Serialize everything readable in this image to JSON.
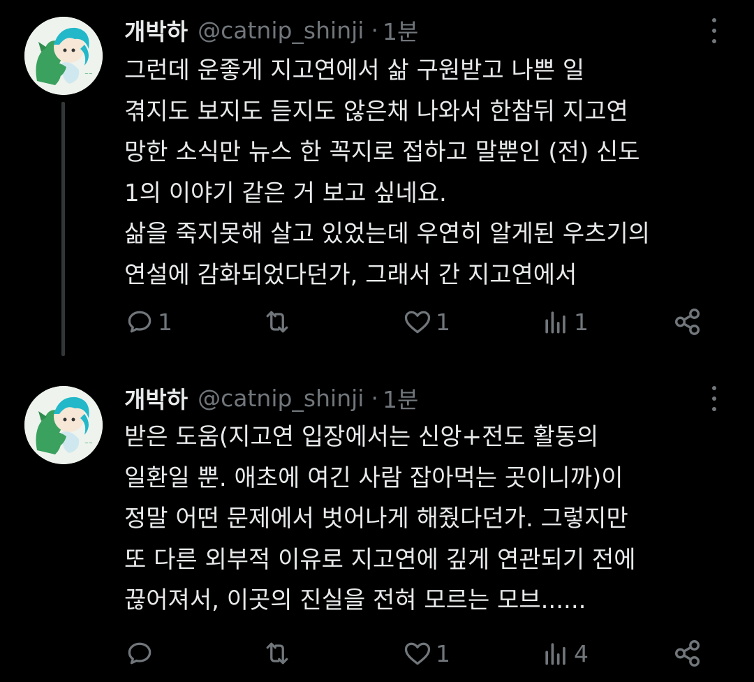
{
  "tweets": [
    {
      "display_name": "개박하",
      "handle": "@catnip_shinji",
      "separator": "·",
      "time": "1분",
      "lines": [
        "그런데 운좋게 지고연에서 삶 구원받고 나쁜 일",
        "겪지도 보지도 듣지도 않은채 나와서 한참뒤 지고연",
        "망한 소식만 뉴스 한 꼭지로 접하고 말뿐인 (전) 신도",
        "1의 이야기 같은 거 보고 싶네요.",
        "삶을 죽지못해 살고 있었는데 우연히 알게된 우츠기의",
        "연설에 감화되었다던가, 그래서 간 지고연에서"
      ],
      "actions": {
        "reply_count": "1",
        "retweet_count": "",
        "like_count": "1",
        "view_count": "1"
      }
    },
    {
      "display_name": "개박하",
      "handle": "@catnip_shinji",
      "separator": "·",
      "time": "1분",
      "lines": [
        "받은 도움(지고연 입장에서는 신앙+전도 활동의",
        "일환일 뿐. 애초에 여긴 사람 잡아먹는 곳이니까)이",
        "정말 어떤 문제에서 벗어나게 해줬다던가. 그렇지만",
        "또 다른 외부적 이유로 지고연에 깊게 연관되기 전에",
        "끊어져서, 이곳의 진실을 전혀 모르는 모브......"
      ],
      "actions": {
        "reply_count": "",
        "retweet_count": "",
        "like_count": "1",
        "view_count": "4"
      }
    }
  ],
  "icons": {
    "reply": "reply-icon",
    "retweet": "retweet-icon",
    "like": "heart-icon",
    "views": "views-icon",
    "share": "share-icon",
    "more": "more-vertical-icon",
    "avatar": "avatar-cartoon-cat-icon"
  },
  "colors": {
    "background": "#000000",
    "text": "#e7e9ea",
    "secondary": "#71767b",
    "thread_line": "#333639"
  }
}
